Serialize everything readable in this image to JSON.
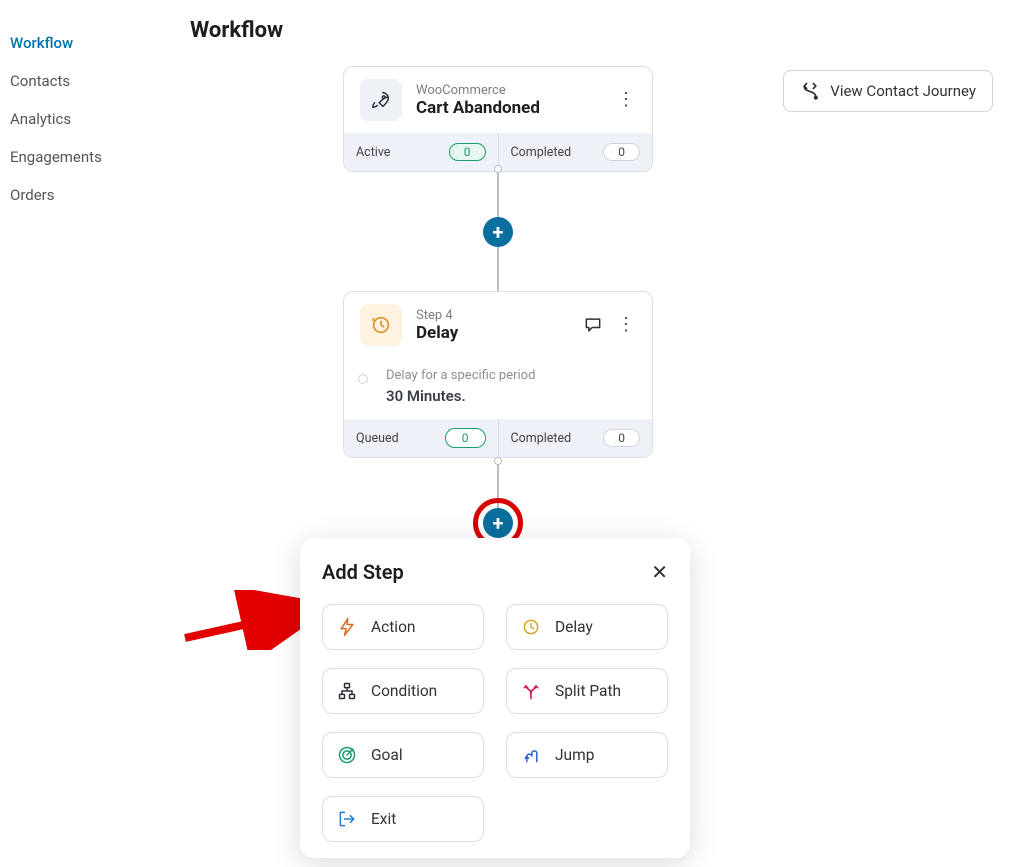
{
  "sidebar": {
    "items": [
      {
        "label": "Workflow",
        "active": true
      },
      {
        "label": "Contacts"
      },
      {
        "label": "Analytics"
      },
      {
        "label": "Engagements"
      },
      {
        "label": "Orders"
      }
    ]
  },
  "page": {
    "title": "Workflow"
  },
  "journey_button": {
    "label": "View Contact Journey"
  },
  "trigger_node": {
    "source": "WooCommerce",
    "title": "Cart Abandoned",
    "foot": {
      "active_label": "Active",
      "active_count": "0",
      "completed_label": "Completed",
      "completed_count": "0"
    }
  },
  "delay_node": {
    "step": "Step 4",
    "title": "Delay",
    "body_sub": "Delay for a specific period",
    "body_title": "30 Minutes.",
    "foot": {
      "queued_label": "Queued",
      "queued_count": "0",
      "completed_label": "Completed",
      "completed_count": "0"
    }
  },
  "add_step": {
    "title": "Add Step",
    "options": {
      "action": "Action",
      "delay": "Delay",
      "condition": "Condition",
      "split": "Split Path",
      "goal": "Goal",
      "jump": "Jump",
      "exit": "Exit"
    }
  }
}
